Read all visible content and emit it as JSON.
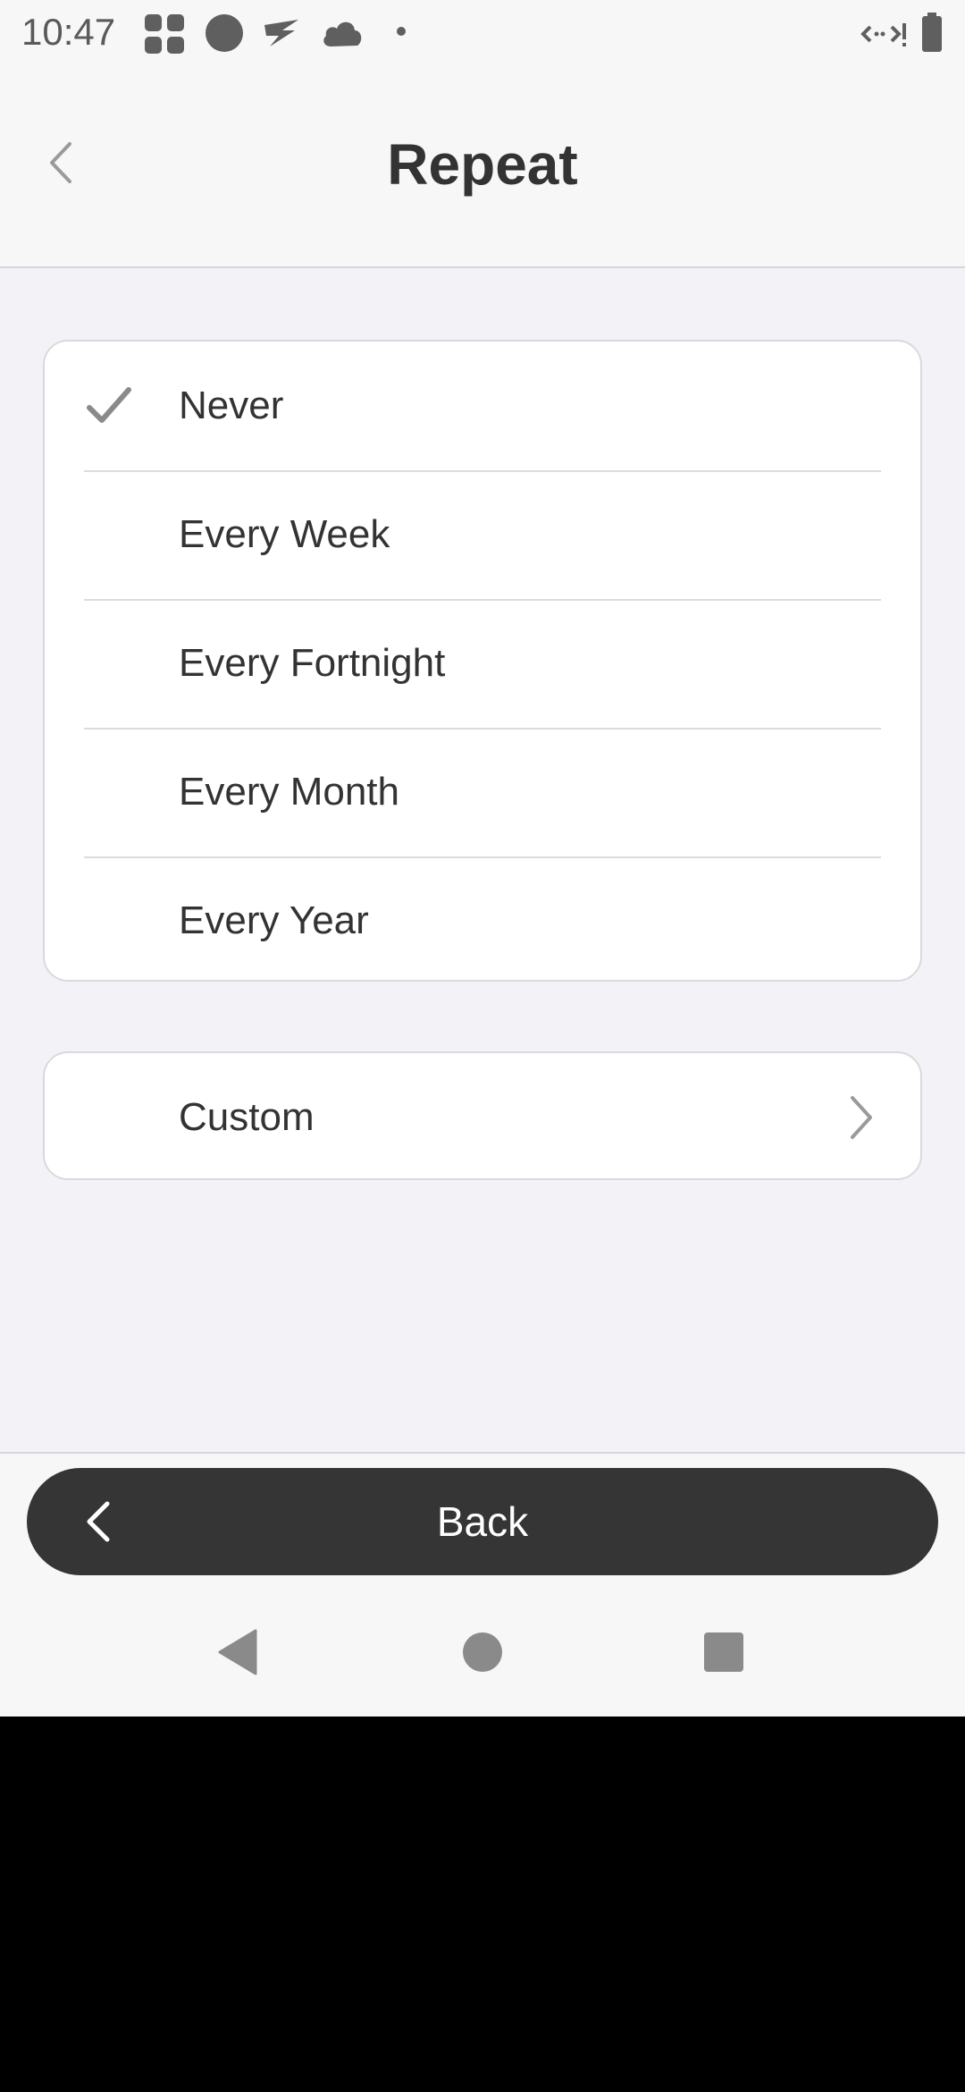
{
  "status_bar": {
    "time": "10:47",
    "left_icons": [
      "app-grid-icon",
      "circle-icon",
      "swoosh-icon",
      "cloud-icon",
      "dot-icon"
    ],
    "right_icons": [
      "data-transfer-icon",
      "battery-icon"
    ]
  },
  "header": {
    "title": "Repeat",
    "back_icon": "chevron-left-icon"
  },
  "options": [
    {
      "label": "Never",
      "selected": true
    },
    {
      "label": "Every Week",
      "selected": false
    },
    {
      "label": "Every Fortnight",
      "selected": false
    },
    {
      "label": "Every Month",
      "selected": false
    },
    {
      "label": "Every Year",
      "selected": false
    }
  ],
  "custom": {
    "label": "Custom",
    "icon": "chevron-right-icon"
  },
  "bottom": {
    "back_label": "Back",
    "back_icon": "chevron-left-icon"
  },
  "nav_bar": {
    "buttons": [
      "nav-back-icon",
      "nav-home-icon",
      "nav-recents-icon"
    ]
  },
  "colors": {
    "background": "#f2f2f7",
    "card": "#ffffff",
    "text": "#333333",
    "check": "#8a8a8a",
    "back_button": "#353535"
  }
}
